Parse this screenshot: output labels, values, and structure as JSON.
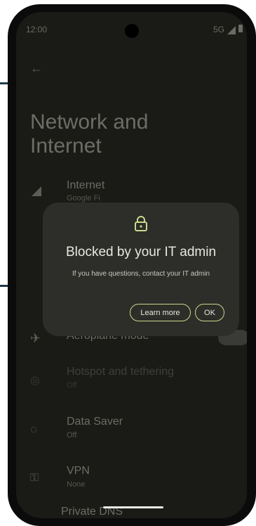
{
  "status": {
    "time": "12:00",
    "network": "5G"
  },
  "page": {
    "title": "Network and Internet"
  },
  "rows": [
    {
      "title": "Internet",
      "subtitle": "Google Fi"
    },
    {
      "title": "Aeroplane mode",
      "subtitle": ""
    },
    {
      "title": "Hotspot and tethering",
      "subtitle": "Off"
    },
    {
      "title": "Data Saver",
      "subtitle": "Off"
    },
    {
      "title": "VPN",
      "subtitle": "None"
    },
    {
      "title": "Private DNS",
      "subtitle": ""
    }
  ],
  "dialog": {
    "title": "Blocked by your IT admin",
    "body": "If you have questions, contact your IT admin",
    "learn_more": "Learn more",
    "ok": "OK"
  },
  "colors": {
    "accent": "#c7d98a",
    "dialog_bg": "#2d2e29",
    "screen_bg": "#1a1b17"
  },
  "icons": {
    "back": "arrow-left-icon",
    "lock": "lock-icon"
  }
}
